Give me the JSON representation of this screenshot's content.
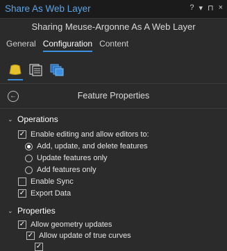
{
  "window": {
    "title": "Share As Web Layer",
    "controls": [
      "?",
      "▾",
      "⊓",
      "×"
    ]
  },
  "subtitle": "Sharing Meuse-Argonne As A Web Layer",
  "tabs": [
    {
      "label": "General",
      "active": false
    },
    {
      "label": "Configuration",
      "active": true
    },
    {
      "label": "Content",
      "active": false
    }
  ],
  "config_icons": [
    "layer-icon",
    "table-icon",
    "layers-stack-icon"
  ],
  "panel": {
    "back_icon": "back-arrow-icon",
    "title": "Feature Properties"
  },
  "operations": {
    "header": "Operations",
    "enable_editing": {
      "label": "Enable editing and allow editors to:",
      "checked": true
    },
    "edit_options": [
      {
        "label": "Add, update, and delete features",
        "selected": true
      },
      {
        "label": "Update features only",
        "selected": false
      },
      {
        "label": "Add features only",
        "selected": false
      }
    ],
    "enable_sync": {
      "label": "Enable Sync",
      "checked": false
    },
    "export_data": {
      "label": "Export Data",
      "checked": true
    }
  },
  "properties": {
    "header": "Properties",
    "allow_geometry_updates": {
      "label": "Allow geometry updates",
      "checked": true
    },
    "allow_true_curves": {
      "label": "Allow update of true curves",
      "checked": true
    }
  },
  "colors": {
    "accent": "#3d92e0",
    "title_blue": "#5ba4e8",
    "background": "#2b2b2b"
  }
}
